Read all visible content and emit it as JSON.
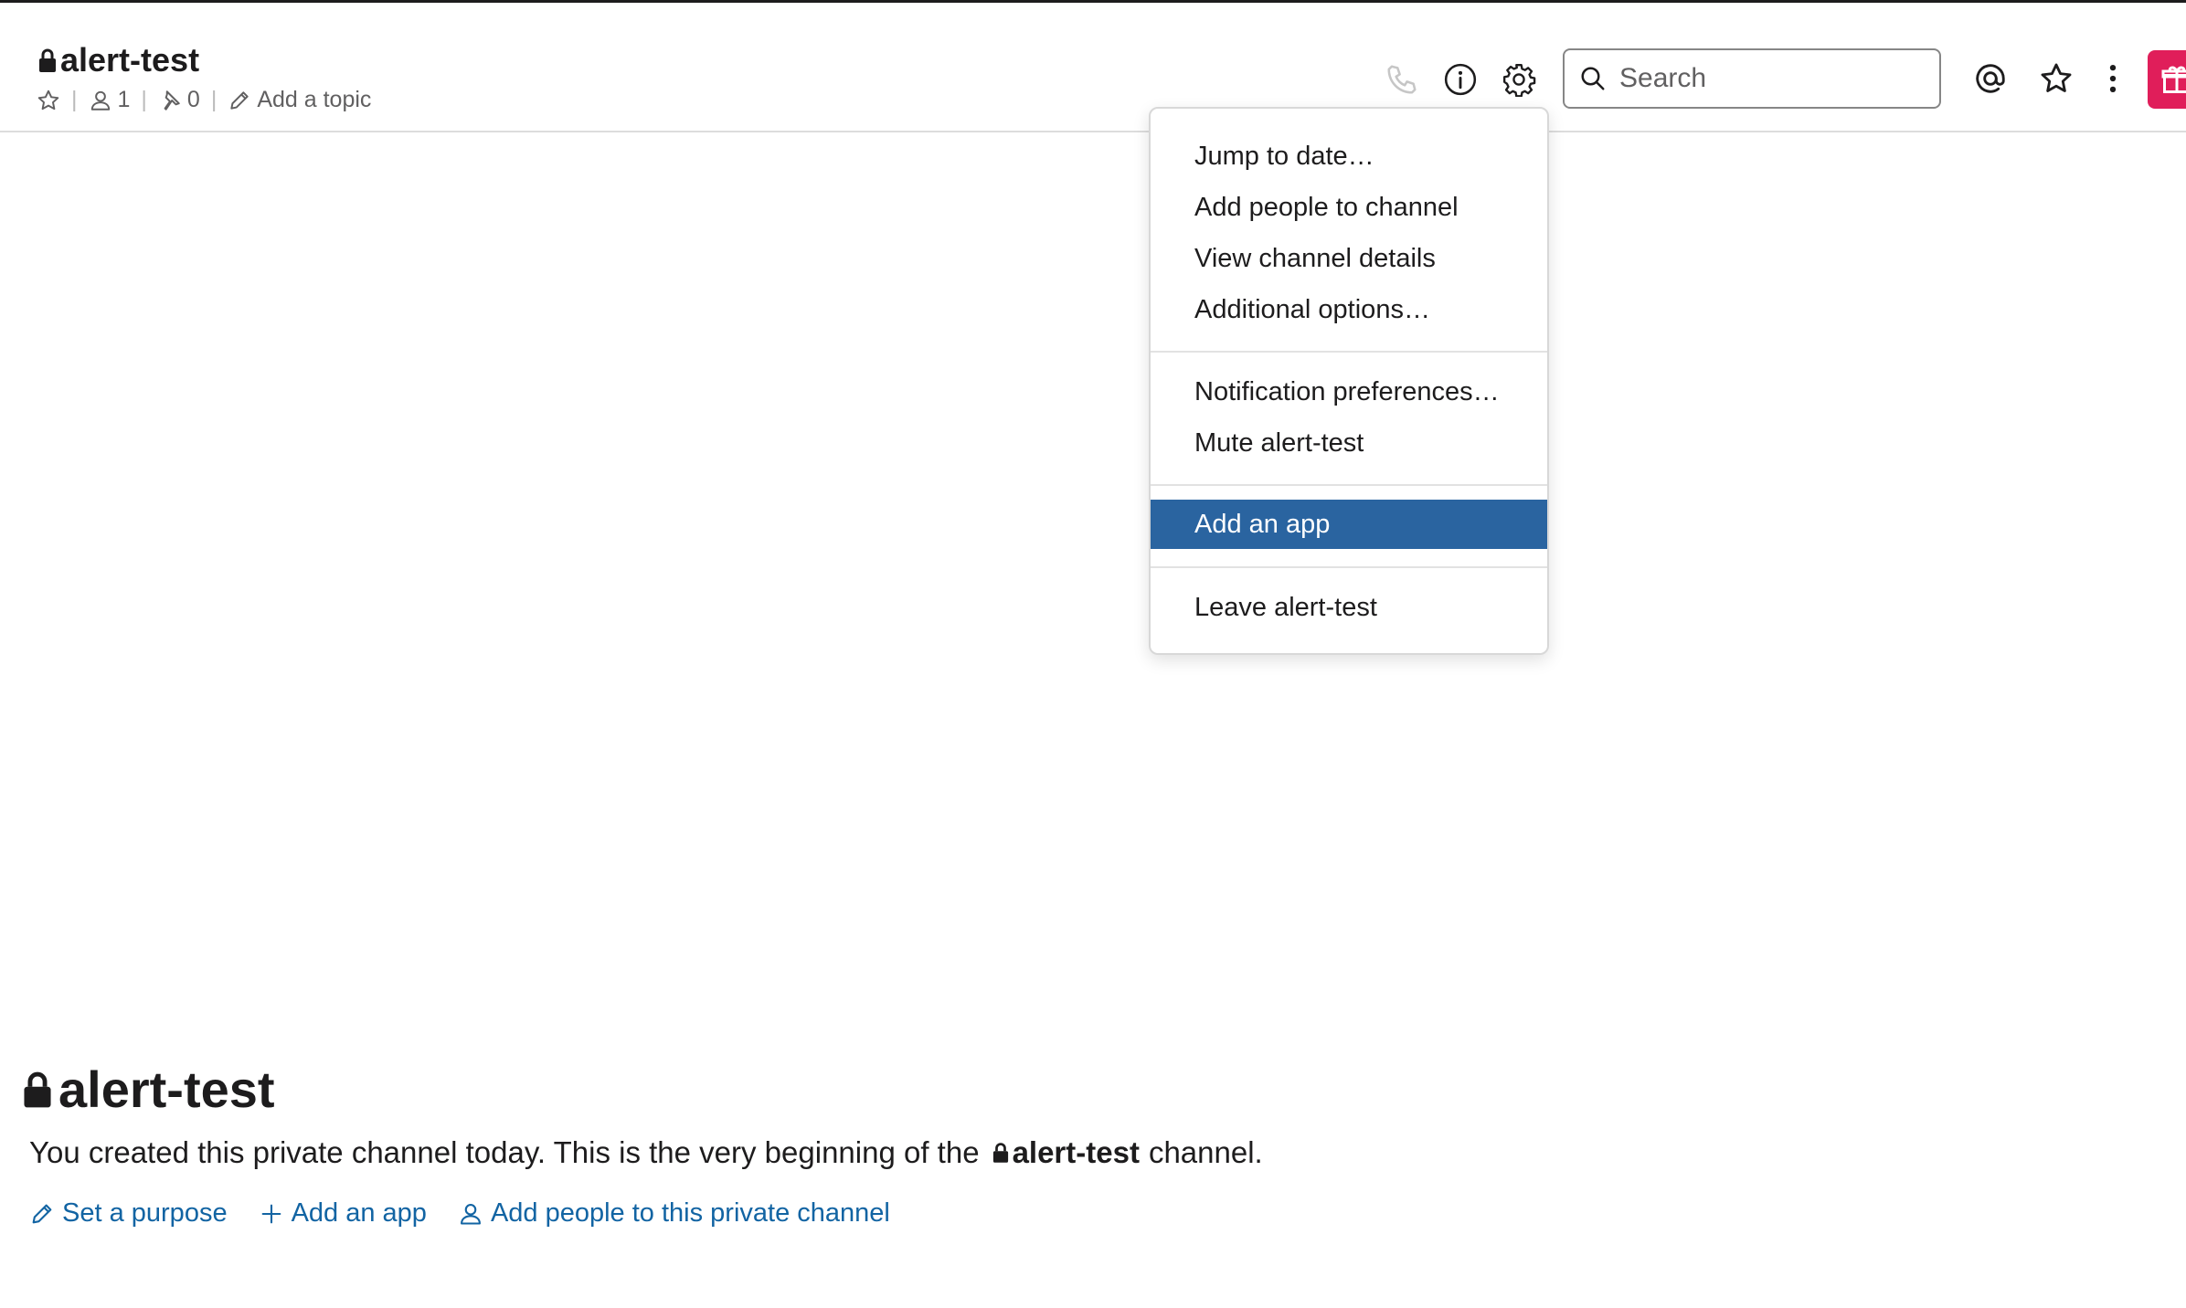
{
  "header": {
    "channel_name": "alert-test",
    "member_count": "1",
    "pin_count": "0",
    "topic_placeholder": "Add a topic"
  },
  "search": {
    "placeholder": "Search"
  },
  "menu": {
    "items": [
      "Jump to date…",
      "Add people to channel",
      "View channel details",
      "Additional options…",
      "Notification preferences…",
      "Mute alert-test",
      "Add an app",
      "Leave alert-test"
    ],
    "highlighted": "Add an app"
  },
  "intro": {
    "title": "alert-test",
    "text_prefix": "You created this private channel today. This is the very beginning of the",
    "channel_name": "alert-test",
    "text_suffix": "channel.",
    "actions": {
      "set_purpose": "Set a purpose",
      "add_app": "Add an app",
      "add_people": "Add people to this private channel"
    }
  },
  "colors": {
    "link": "#1264a3",
    "highlight": "#2a64a0",
    "gift": "#e01e5a"
  },
  "icons": [
    "lock-icon",
    "star-icon",
    "member-icon",
    "pin-icon",
    "pencil-icon",
    "phone-icon",
    "info-icon",
    "gear-icon",
    "search-icon",
    "mention-icon",
    "more-vertical-icon",
    "gift-icon",
    "plus-icon"
  ]
}
